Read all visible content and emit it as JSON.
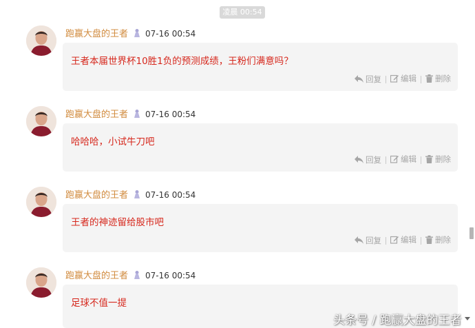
{
  "time_divider": "凌晨 00:54",
  "messages": [
    {
      "name": "跑赢大盘的王者",
      "time": "07-16 00:54",
      "text": "王者本届世界杯10胜1负的预测成绩，王粉们满意吗？",
      "reply": "回复",
      "edit": "编辑",
      "delete": "删除"
    },
    {
      "name": "跑赢大盘的王者",
      "time": "07-16 00:54",
      "text": "哈哈哈，小试牛刀吧",
      "reply": "回复",
      "edit": "编辑",
      "delete": "删除"
    },
    {
      "name": "跑赢大盘的王者",
      "time": "07-16 00:54",
      "text": "王者的神迹留给股市吧",
      "reply": "回复",
      "edit": "编辑",
      "delete": "删除"
    },
    {
      "name": "跑赢大盘的王者",
      "time": "07-16 00:54",
      "text": "足球不值一提"
    }
  ],
  "watermark": "头条号 / 跑赢大盘的王者",
  "colors": {
    "name": "#d18b3e",
    "message_text": "#d6271c",
    "bubble": "#f4f4f4",
    "action": "#a6a6a6"
  },
  "icons": [
    "badge-icon",
    "reply-icon",
    "edit-icon",
    "delete-icon",
    "avatar"
  ]
}
